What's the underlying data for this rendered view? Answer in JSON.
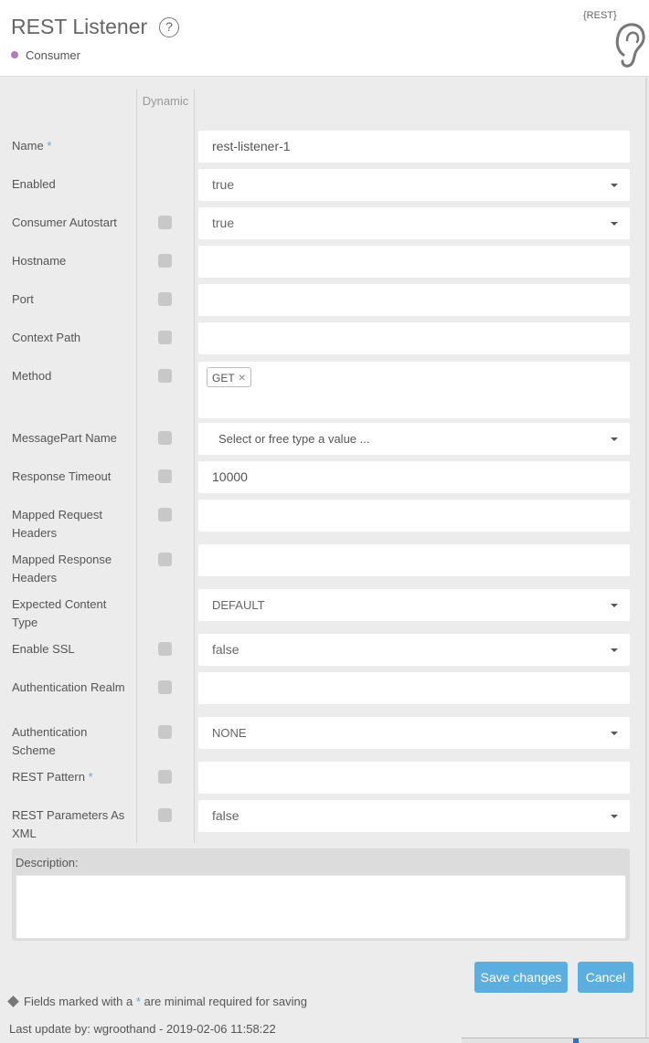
{
  "header": {
    "title": "REST Listener",
    "help_icon": "?",
    "type_label": "Consumer",
    "type_dot_color": "#b57bbf",
    "logo_text": "{REST}",
    "logo_icon": "ear-icon"
  },
  "form": {
    "dynamic_header": "Dynamic",
    "fields": {
      "name": {
        "label": "Name",
        "required": "*",
        "value": "rest-listener-1"
      },
      "enabled": {
        "label": "Enabled",
        "value": "true"
      },
      "consumer_autostart": {
        "label": "Consumer Autostart",
        "value": "true"
      },
      "hostname": {
        "label": "Hostname",
        "value": ""
      },
      "port": {
        "label": "Port",
        "value": ""
      },
      "context_path": {
        "label": "Context Path",
        "value": ""
      },
      "method": {
        "label": "Method",
        "tag": "GET",
        "tag_remove": "×"
      },
      "messagepart_name": {
        "label": "MessagePart Name",
        "placeholder": "Select or free type a value ..."
      },
      "response_timeout": {
        "label": "Response Timeout",
        "value": "10000"
      },
      "mapped_request_headers": {
        "label": "Mapped Request Headers",
        "value": ""
      },
      "mapped_response_headers": {
        "label": "Mapped Response Headers",
        "value": ""
      },
      "expected_content_type": {
        "label": "Expected Content Type",
        "value": "DEFAULT"
      },
      "enable_ssl": {
        "label": "Enable SSL",
        "value": "false"
      },
      "authentication_realm": {
        "label": "Authentication Realm",
        "value": ""
      },
      "authentication_scheme": {
        "label": "Authentication Scheme",
        "value": "NONE"
      },
      "rest_pattern": {
        "label": "REST Pattern",
        "required": "*",
        "value": ""
      },
      "rest_parameters_as_xml": {
        "label": "REST Parameters As XML",
        "value": "false"
      }
    },
    "description_label": "Description:",
    "description_value": ""
  },
  "actions": {
    "save_label": "Save changes",
    "cancel_label": "Cancel",
    "accent_color": "#5bafe0"
  },
  "footer": {
    "note_prefix": "Fields marked with a ",
    "note_star": "*",
    "note_suffix": " are minimal required for saving",
    "last_update": "Last update by: wgroothand - 2019-02-06 11:58:22"
  }
}
